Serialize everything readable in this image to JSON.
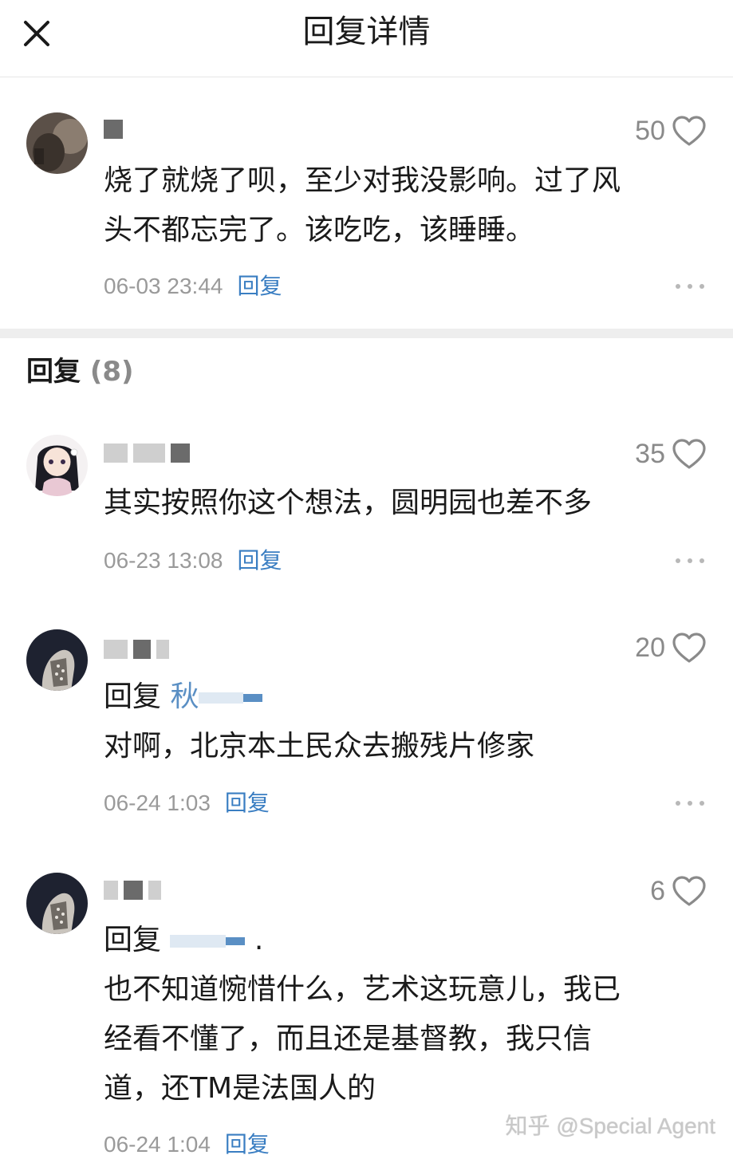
{
  "header": {
    "title": "回复详情"
  },
  "main_comment": {
    "likes": "50",
    "text_line1": "烧了就烧了呗，至少对我没影响。过了风",
    "text_line2": "头不都忘完了。该吃吃，该睡睡。",
    "time": "06-03 23:44",
    "reply_label": "回复"
  },
  "replies_section": {
    "title": "回复",
    "count": "(8)"
  },
  "replies": [
    {
      "likes": "35",
      "text": "其实按照你这个想法，圆明园也差不多",
      "time": "06-23 13:08",
      "reply_label": "回复"
    },
    {
      "likes": "20",
      "reply_to_label": "回复",
      "reply_to_name": "秋",
      "text": "对啊，北京本土民众去搬残片修家",
      "time": "06-24 1:03",
      "reply_label": "回复"
    },
    {
      "likes": "6",
      "reply_to_label": "回复",
      "text_line1": "也不知道惋惜什么，艺术这玩意儿，我已",
      "text_line2": "经看不懂了，而且还是基督教，我只信",
      "text_line3": "道，还TM是法国人的",
      "time": "06-24 1:04",
      "reply_label": "回复"
    }
  ],
  "watermark": "知乎 @Special Agent",
  "colors": {
    "link": "#3a7ec2",
    "reply_name": "#5a8fc4",
    "muted": "#9a9a9a"
  }
}
